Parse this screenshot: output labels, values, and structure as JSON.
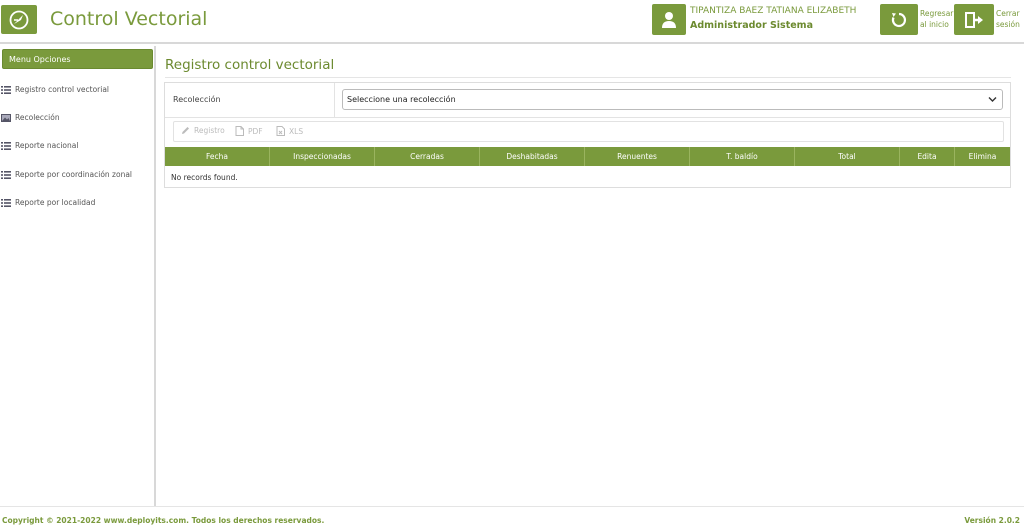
{
  "header": {
    "app_title": "Control Vectorial",
    "user_name": "TIPANTIZA BAEZ TATIANA ELIZABETH",
    "user_role": "Administrador Sistema",
    "home_label": "Regresar al inicio",
    "logout_label": "Cerrar sesión"
  },
  "sidebar": {
    "header": "Menu Opciones",
    "items": [
      {
        "label": "Registro control vectorial",
        "icon": "list-icon"
      },
      {
        "label": "Recolección",
        "icon": "image-icon"
      },
      {
        "label": "Reporte nacional",
        "icon": "list-icon"
      },
      {
        "label": "Reporte por coordinación zonal",
        "icon": "list-icon"
      },
      {
        "label": "Reporte por localidad",
        "icon": "list-icon"
      }
    ]
  },
  "main": {
    "title": "Registro control vectorial",
    "select_label": "Recolección",
    "select_value": "Seleccione una recolección",
    "toolbar": {
      "registro": "Registro",
      "pdf": "PDF",
      "xls": "XLS"
    },
    "columns": [
      "Fecha",
      "Inspeccionadas",
      "Cerradas",
      "Deshabitadas",
      "Renuentes",
      "T. baldío",
      "Total",
      "Edita",
      "Elimina"
    ],
    "empty_message": "No records found."
  },
  "footer": {
    "copyright": "Copyright © 2021-2022 www.deployits.com. Todos los derechos reservados.",
    "version": "Versión 2.0.2"
  },
  "colors": {
    "accent": "#7a9a3c",
    "border": "#d8d8d8"
  }
}
